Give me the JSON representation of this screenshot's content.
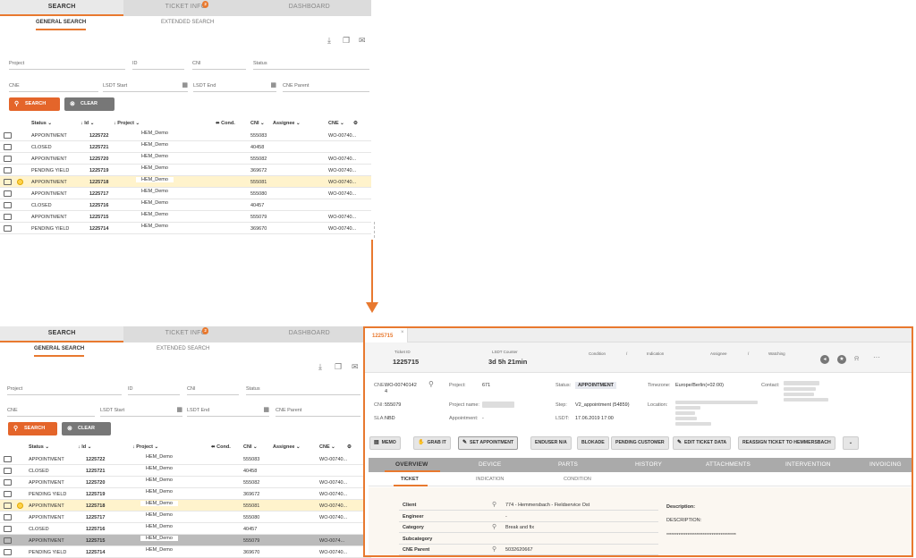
{
  "panel_tabs": [
    {
      "label": "SEARCH"
    },
    {
      "label": "TICKET INFO",
      "badge": "2"
    },
    {
      "label": "DASHBOARD"
    }
  ],
  "subtabs": [
    "GENERAL SEARCH",
    "EXTENDED SEARCH"
  ],
  "filters": {
    "project": "Project",
    "id": "ID",
    "cni": "CNI",
    "status": "Status",
    "cne": "CNE",
    "lsdt_start": "LSDT Start",
    "lsdt_end": "LSDT End",
    "cne_parent": "CNE Parent"
  },
  "buttons": {
    "search": "SEARCH",
    "clear": "CLEAR"
  },
  "columns": {
    "status": "Status",
    "id": "Id",
    "project": "Project",
    "cond": "Cond.",
    "cni": "CNI",
    "assignee": "Assignee",
    "cne": "CNE"
  },
  "rows_top": [
    {
      "status": "APPOINTMENT",
      "id": "1225722",
      "project": "HEM_Demo",
      "cni": "555083",
      "cne": "WO-00740..."
    },
    {
      "status": "CLOSED",
      "id": "1225721",
      "project": "HEM_Demo",
      "cni": "40458",
      "cne": ""
    },
    {
      "status": "APPOINTMENT",
      "id": "1225720",
      "project": "HEM_Demo",
      "cni": "555082",
      "cne": "WO-00740..."
    },
    {
      "status": "PENDING YIELD",
      "id": "1225719",
      "project": "HEM_Demo",
      "cni": "369672",
      "cne": "WO-00740..."
    },
    {
      "status": "APPOINTMENT",
      "id": "1225718",
      "project": "HEM_Demo",
      "cni": "555081",
      "cne": "WO-00740..."
    },
    {
      "status": "APPOINTMENT",
      "id": "1225717",
      "project": "HEM_Demo",
      "cni": "555080",
      "cne": "WO-00740..."
    },
    {
      "status": "CLOSED",
      "id": "1225716",
      "project": "HEM_Demo",
      "cni": "40457",
      "cne": ""
    },
    {
      "status": "APPOINTMENT",
      "id": "1225715",
      "project": "HEM_Demo",
      "cni": "555079",
      "cne": "WO-00740..."
    },
    {
      "status": "PENDING YIELD",
      "id": "1225714",
      "project": "HEM_Demo",
      "cni": "369670",
      "cne": "WO-00740..."
    }
  ],
  "rows_bottom": [
    {
      "status": "APPOINTMENT",
      "id": "1225722",
      "project": "HEM_Demo",
      "cni": "555083",
      "cne": "WO-00740..."
    },
    {
      "status": "CLOSED",
      "id": "1225721",
      "project": "HEM_Demo",
      "cni": "40458",
      "cne": ""
    },
    {
      "status": "APPOINTMENT",
      "id": "1225720",
      "project": "HEM_Demo",
      "cni": "555082",
      "cne": "WO-00740..."
    },
    {
      "status": "PENDING YIELD",
      "id": "1225719",
      "project": "HEM_Demo",
      "cni": "369672",
      "cne": "WO-00740..."
    },
    {
      "status": "APPOINTMENT",
      "id": "1225718",
      "project": "HEM_Demo",
      "cni": "555081",
      "cne": "WO-00740..."
    },
    {
      "status": "APPOINTMENT",
      "id": "1225717",
      "project": "HEM_Demo",
      "cni": "555080",
      "cne": "WO-00740..."
    },
    {
      "status": "CLOSED",
      "id": "1225716",
      "project": "HEM_Demo",
      "cni": "40457",
      "cne": ""
    },
    {
      "status": "APPOINTMENT",
      "id": "1225715",
      "project": "HEM_Demo",
      "cni": "555079",
      "cne": "WO-0074..."
    },
    {
      "status": "PENDING YIELD",
      "id": "1225714",
      "project": "HEM_Demo",
      "cni": "369670",
      "cne": "WO-00740..."
    }
  ],
  "detail": {
    "tab": "1225715",
    "ticket_id_label": "Ticket ID",
    "ticket_id": "1225715",
    "lsdt_counter_label": "LSDT Counter",
    "lsdt_counter": "3d 5h 21min",
    "condition_label": "Condition",
    "indication_label": "Indication",
    "assignee_label": "Assignee",
    "watching_label": "Watching",
    "slash": "/",
    "cne_label": "CNE:",
    "cne_value": "WO-00740142",
    "cne_value2": "4",
    "project_label": "Project:",
    "project_value": "671",
    "status_label": "Status:",
    "status_value": "APPOINTMENT",
    "timezone_label": "Timezone:",
    "timezone_value": "Europe/Berlin(+02:00)",
    "contact_label": "Contact:",
    "cni_label": "CNI:",
    "cni_value": "555079",
    "project_name_label": "Project name:",
    "step_label": "Step:",
    "step_value": "V2_appointment (54859)",
    "location_label": "Location:",
    "sla_label": "SLA:",
    "sla_value": "NBD",
    "appointment_label": "Appointment:",
    "appointment_value": "-",
    "lsdt_label": "LSDT:",
    "lsdt_value": "17.06.2019 17:00",
    "actions": [
      "MEMO",
      "GRAB IT",
      "SET APPOINTMENT",
      "ENDUSER N/A",
      "BLOKADE",
      "PENDING CUSTOMER",
      "EDIT TICKET DATA",
      "REASSIGN TICKET TO HEMMERSBACH"
    ],
    "main_tabs": [
      "OVERVIEW",
      "DEVICE",
      "PARTS",
      "HISTORY",
      "ATTACHMENTS",
      "INTERVENTION",
      "INVOICING"
    ],
    "sub_tabs": [
      "TICKET",
      "INDICATION",
      "CONDITION"
    ],
    "fields": [
      {
        "k": "Client",
        "v": "774 - Hemmersbach - Fieldservice Ost",
        "mag": true
      },
      {
        "k": "Engineer",
        "v": "-",
        "mag": false
      },
      {
        "k": "Category",
        "v": "Break and fix",
        "mag": true
      },
      {
        "k": "Subcategory",
        "v": "",
        "mag": false
      },
      {
        "k": "CNE Parent",
        "v": "5032620667",
        "mag": true
      }
    ],
    "description_label": "Description:",
    "description_value": "DESCRIPTION:",
    "description_stars": "****************************************"
  },
  "colors": {
    "accent": "#e8792f",
    "search_btn": "#e4652a",
    "clear_btn": "#777777",
    "selected_row": "#fff3cc"
  }
}
